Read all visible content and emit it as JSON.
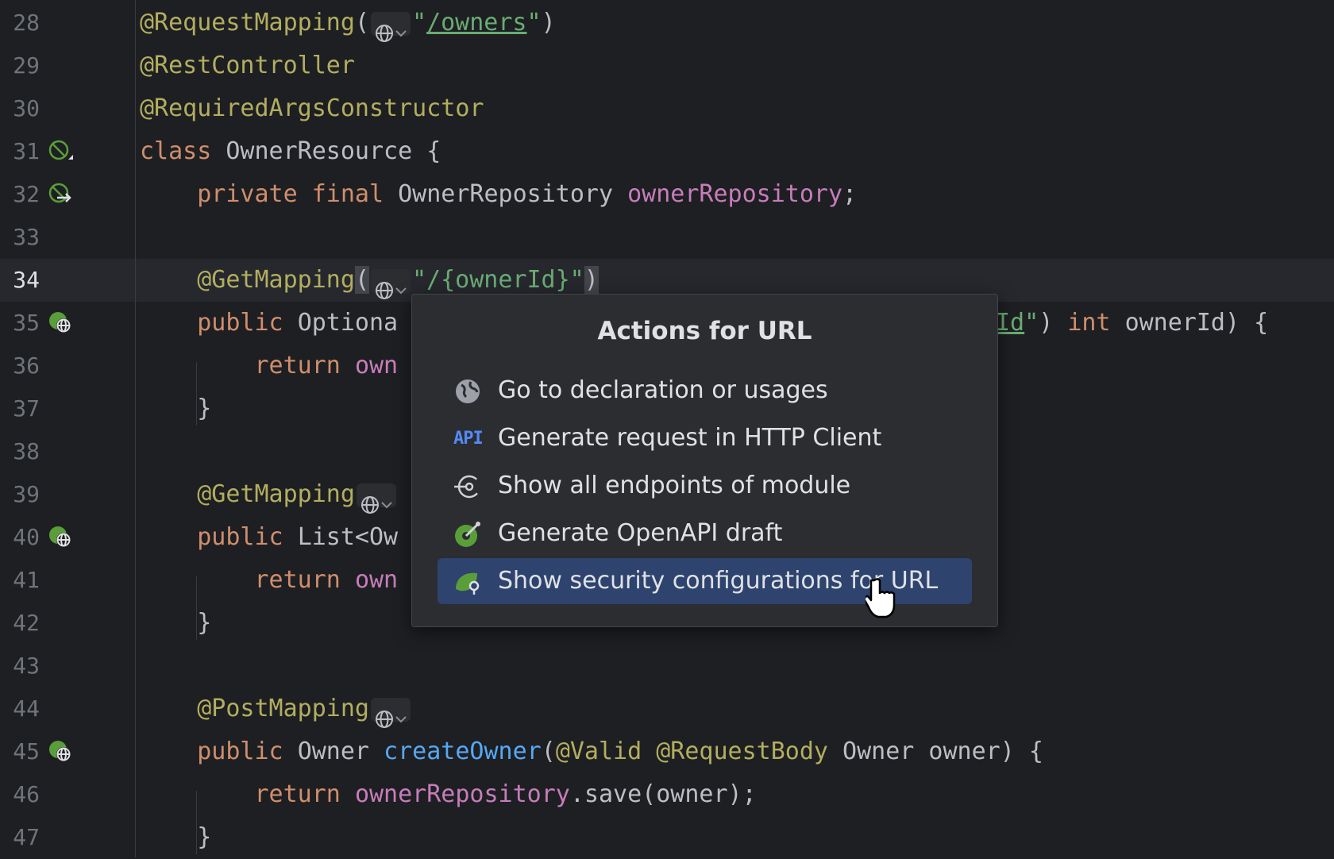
{
  "editor": {
    "lines": [
      {
        "number": "28",
        "tokens": [
          [
            "ann",
            "@RequestMapping"
          ],
          [
            "plain",
            "("
          ],
          [
            "inlay",
            ""
          ],
          [
            "str",
            "\""
          ],
          [
            "url",
            "/owners"
          ],
          [
            "str",
            "\""
          ],
          [
            "plain",
            ")"
          ]
        ]
      },
      {
        "number": "29",
        "tokens": [
          [
            "ann",
            "@RestController"
          ]
        ]
      },
      {
        "number": "30",
        "tokens": [
          [
            "ann",
            "@RequiredArgsConstructor"
          ]
        ]
      },
      {
        "number": "31",
        "tokens": [
          [
            "kw",
            "class "
          ],
          [
            "plain",
            "OwnerResource {"
          ]
        ]
      },
      {
        "number": "32",
        "tokens": [
          [
            "kw",
            "    private final "
          ],
          [
            "plain",
            "OwnerRepository "
          ],
          [
            "fld",
            "ownerRepository"
          ],
          [
            "plain",
            ";"
          ]
        ]
      },
      {
        "number": "33",
        "tokens": []
      },
      {
        "number": "34",
        "tokens": [
          [
            "ann",
            "    @GetMapping"
          ],
          [
            "plain",
            "("
          ],
          [
            "inlay",
            ""
          ],
          [
            "str",
            "\"/{ownerId}\""
          ],
          [
            "plain",
            ")"
          ]
        ]
      },
      {
        "number": "35",
        "tokens": [
          [
            "kw",
            "    public "
          ],
          [
            "plain",
            "Optiona"
          ]
        ]
      },
      {
        "number": "36",
        "tokens": [
          [
            "kw",
            "        return "
          ],
          [
            "fld",
            "own"
          ]
        ]
      },
      {
        "number": "37",
        "tokens": [
          [
            "plain",
            "    }"
          ]
        ]
      },
      {
        "number": "38",
        "tokens": []
      },
      {
        "number": "39",
        "tokens": [
          [
            "ann",
            "    @GetMapping"
          ],
          [
            "inlay",
            ""
          ]
        ]
      },
      {
        "number": "40",
        "tokens": [
          [
            "kw",
            "    public "
          ],
          [
            "plain",
            "List<Ow"
          ]
        ]
      },
      {
        "number": "41",
        "tokens": [
          [
            "kw",
            "        return "
          ],
          [
            "fld",
            "own"
          ]
        ]
      },
      {
        "number": "42",
        "tokens": [
          [
            "plain",
            "    }"
          ]
        ]
      },
      {
        "number": "43",
        "tokens": []
      },
      {
        "number": "44",
        "tokens": [
          [
            "ann",
            "    @PostMapping"
          ],
          [
            "inlay",
            ""
          ]
        ]
      },
      {
        "number": "45",
        "tokens": [
          [
            "kw",
            "    public "
          ],
          [
            "plain",
            "Owner "
          ],
          [
            "fn",
            "createOwner"
          ],
          [
            "plain",
            "("
          ],
          [
            "ann",
            "@Valid @RequestBody "
          ],
          [
            "plain",
            "Owner owner) {"
          ]
        ]
      },
      {
        "number": "46",
        "tokens": [
          [
            "kw",
            "        return "
          ],
          [
            "fld",
            "ownerRepository"
          ],
          [
            "plain",
            ".save(owner);"
          ]
        ]
      },
      {
        "number": "47",
        "tokens": [
          [
            "plain",
            "    }"
          ]
        ]
      }
    ],
    "line35_tail": [
      [
        "url",
        "Id"
      ],
      [
        "str",
        "\""
      ],
      [
        "plain",
        ") "
      ],
      [
        "kw",
        "int "
      ],
      [
        "plain",
        "ownerId) {"
      ]
    ]
  },
  "gutter_icons": {
    "31": "bean-class-icon",
    "32": "bean-injection-icon",
    "35": "endpoint-globe-icon",
    "40": "endpoint-globe-icon",
    "45": "endpoint-globe-icon"
  },
  "popup": {
    "title": "Actions for URL",
    "items": [
      {
        "label": "Go to declaration or usages",
        "icon": "globe-icon",
        "selected": false
      },
      {
        "label": "Generate request in HTTP Client",
        "icon": "api-icon",
        "icon_text": "API",
        "selected": false
      },
      {
        "label": "Show all endpoints of module",
        "icon": "endpoints-icon",
        "selected": false
      },
      {
        "label": "Generate OpenAPI draft",
        "icon": "openapi-icon",
        "selected": false
      },
      {
        "label": "Show security configurations for URL",
        "icon": "security-icon",
        "selected": true
      }
    ]
  },
  "colors": {
    "background": "#1e1f22",
    "annotation": "#b3ae60",
    "keyword": "#cf8e6d",
    "field": "#c77dbb",
    "string": "#6aab73",
    "function": "#56a8f5",
    "selection": "#2e436e"
  }
}
